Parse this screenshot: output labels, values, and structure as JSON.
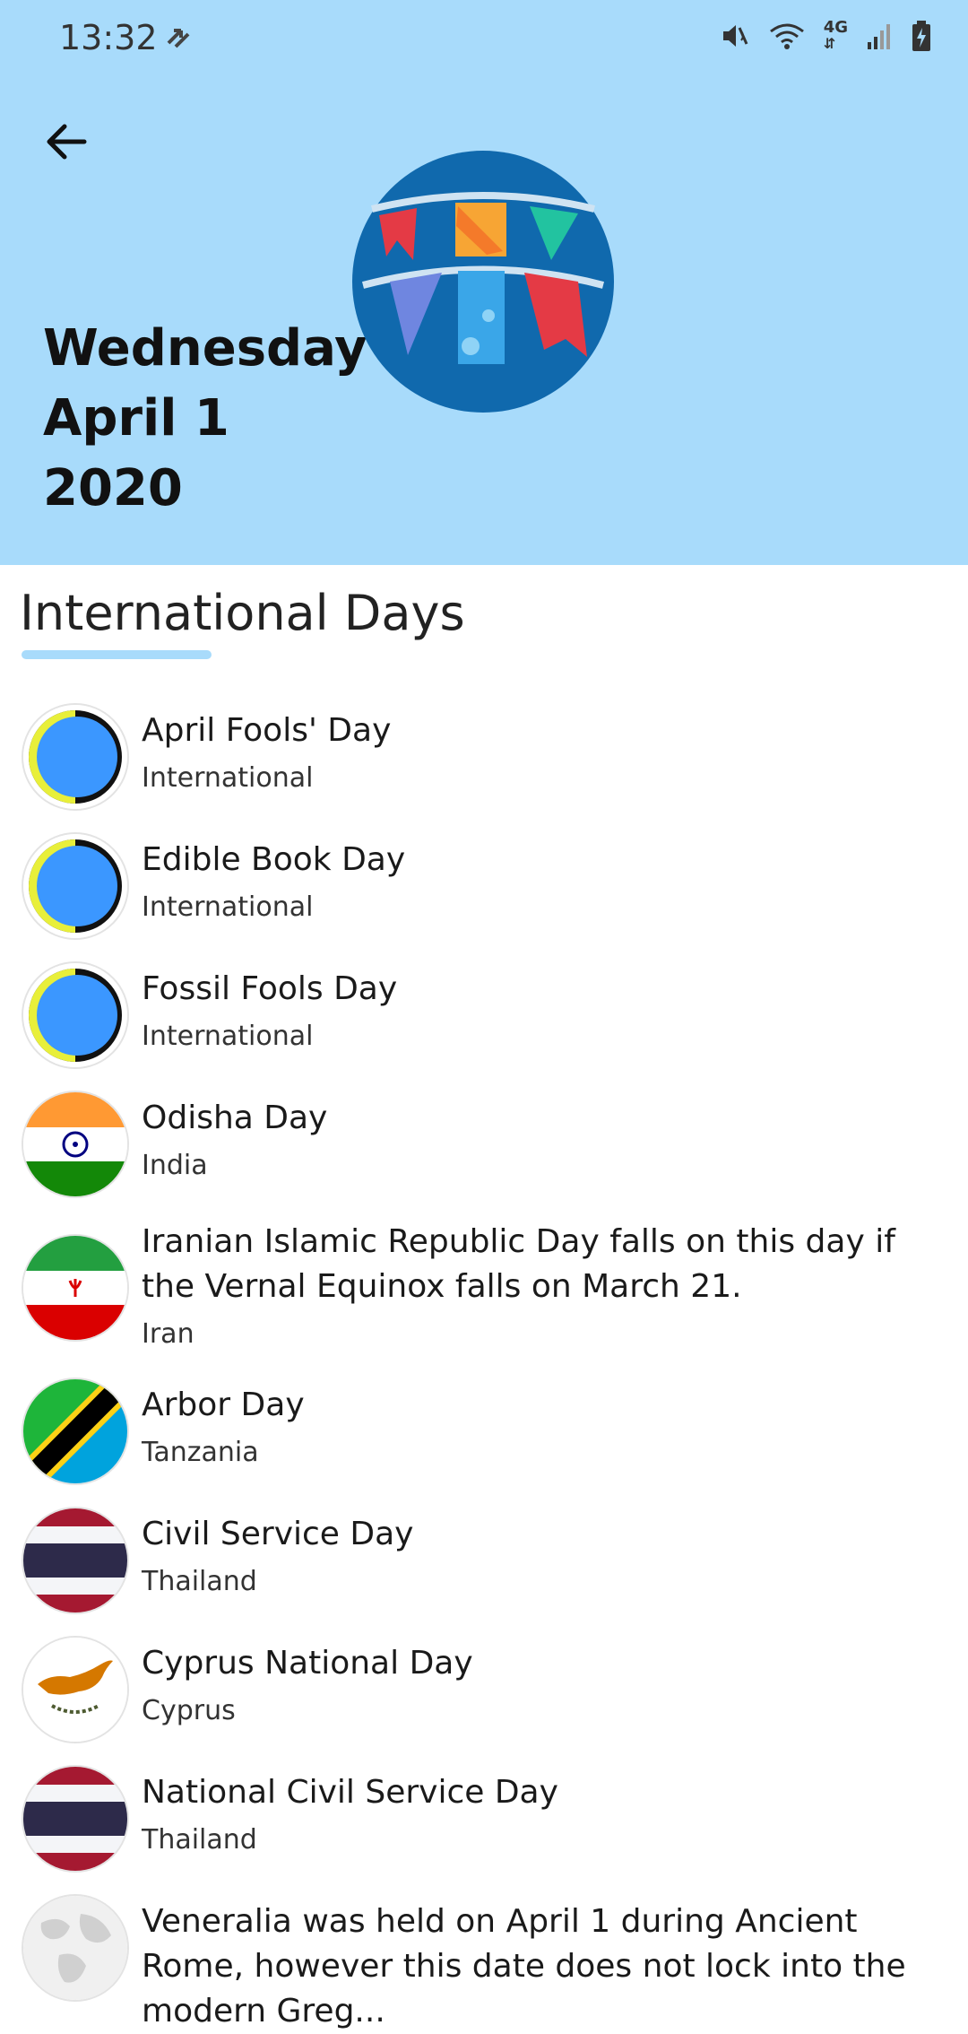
{
  "status_bar": {
    "time": "13:32",
    "network": "4G",
    "icons": [
      "sync-icon",
      "mute-vibrate-icon",
      "wifi-icon",
      "mobile-data-icon",
      "signal-icon",
      "battery-charging-icon"
    ]
  },
  "header": {
    "back_icon": "arrow-left-icon",
    "weekday": "Wednesday",
    "month_day": "April 1",
    "year": "2020",
    "emblem": "bunting-flags-icon",
    "background": "#a8dbfb"
  },
  "section": {
    "title": "International Days",
    "accent": "#a8dbfb"
  },
  "days": [
    {
      "name": "April Fools' Day",
      "region": "International",
      "icon": "globe-ring-icon"
    },
    {
      "name": "Edible Book Day",
      "region": "International",
      "icon": "globe-ring-icon"
    },
    {
      "name": "Fossil Fools Day",
      "region": "International",
      "icon": "globe-ring-icon"
    },
    {
      "name": "Odisha Day",
      "region": "India",
      "icon": "flag-india-icon"
    },
    {
      "name": "Iranian Islamic Republic Day  falls on this day if the Vernal Equinox falls on March 21.",
      "region": "Iran",
      "icon": "flag-iran-icon"
    },
    {
      "name": "Arbor Day",
      "region": "Tanzania",
      "icon": "flag-tanzania-icon"
    },
    {
      "name": "Civil Service Day",
      "region": "Thailand",
      "icon": "flag-thailand-icon"
    },
    {
      "name": "Cyprus National Day",
      "region": "Cyprus",
      "icon": "flag-cyprus-icon"
    },
    {
      "name": "National Civil Service Day",
      "region": "Thailand",
      "icon": "flag-thailand-icon"
    },
    {
      "name": "Veneralia was held on April 1 during Ancient Rome, however this date does not lock into the modern Greg...",
      "region": "",
      "icon": "world-globe-icon"
    }
  ]
}
